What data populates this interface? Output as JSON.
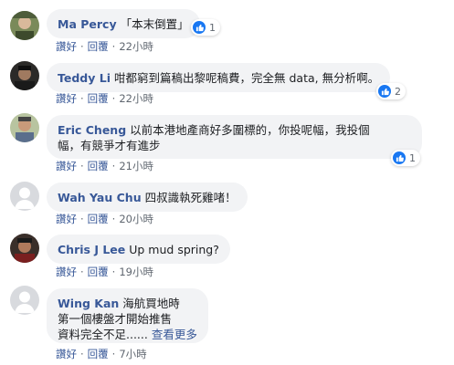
{
  "labels": {
    "like": "讚好",
    "reply": "回覆",
    "separator": "·"
  },
  "colors": {
    "author": "#385898",
    "bubble": "#f2f3f5",
    "like_badge": "#1877f2",
    "meta": "#606770"
  },
  "comments": [
    {
      "author": "Ma Percy",
      "text": "「本末倒置」",
      "time": "22小時",
      "reactions": "1"
    },
    {
      "author": "Teddy Li",
      "text": "咁都窮到篇稿出黎呢稿費，完全無 data, 無分析啊。",
      "time": "22小時",
      "reactions": "2"
    },
    {
      "author": "Eric Cheng",
      "text_line1": "以前本港地產商好多圍標的，你投呢幅，我投個",
      "text_line2": "幅，有競爭才有進步",
      "time": "21小時",
      "reactions": "1"
    },
    {
      "author": "Wah Yau Chu",
      "text": "四叔識執死雞啫！",
      "time": "20小時"
    },
    {
      "author": "Chris J Lee",
      "text": "Up mud spring?",
      "time": "19小時"
    },
    {
      "author": "Wing Kan",
      "text_line1": "海航買地時",
      "text_line2": "第一個樓盤才開始推售",
      "text_line3": "資料完全不足......",
      "see_more": "查看更多",
      "time": "7小時"
    }
  ]
}
